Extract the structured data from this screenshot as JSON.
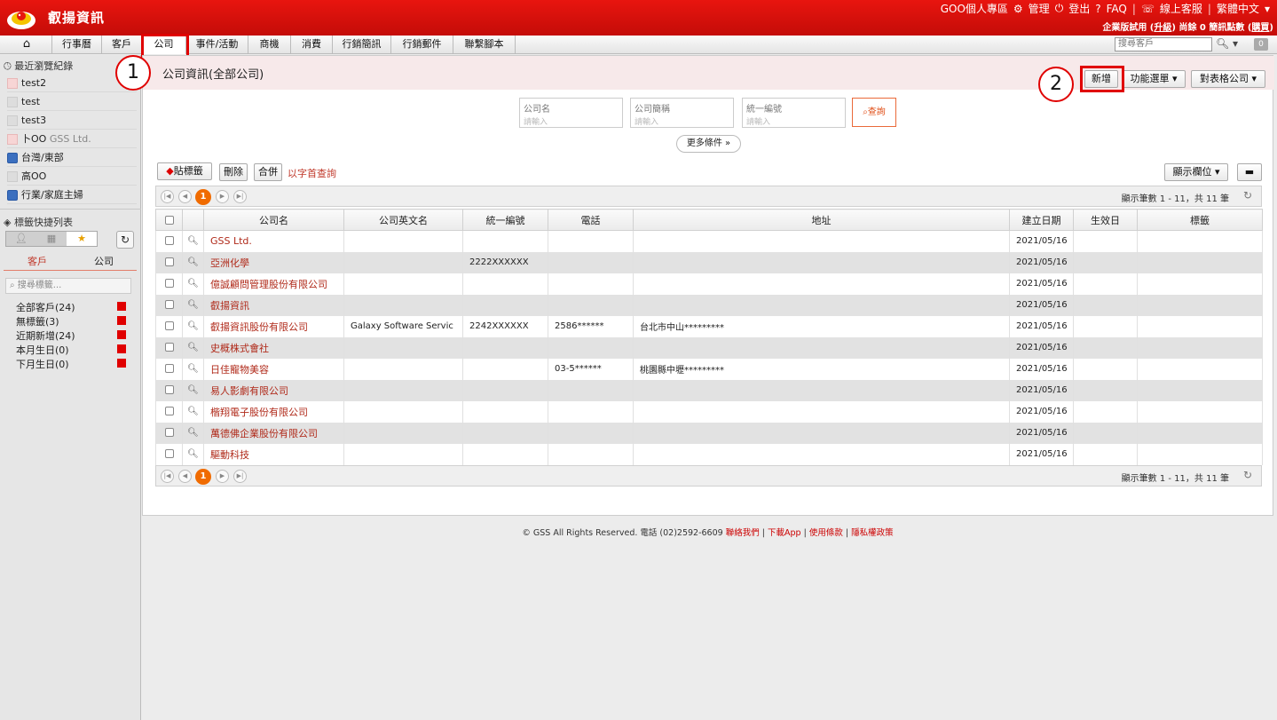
{
  "app": {
    "brand": "叡揚資訊"
  },
  "top_links": {
    "personal": "GOO個人專區",
    "manage": "管理",
    "logout": "登出",
    "faq": "FAQ",
    "support": "線上客服",
    "lang": "繁體中文",
    "plan_prefix": "企業版試用 (",
    "plan_upgrade": "升級",
    "plan_mid": ") 尚餘 0 簡訊點數 (",
    "plan_buy": "購買",
    "plan_suffix": ")"
  },
  "nav": {
    "home_icon": "home-icon",
    "items": [
      "行事曆",
      "客戶",
      "公司",
      "事件/活動",
      "商機",
      "消費",
      "行銷簡訊",
      "行銷郵件",
      "聯繫腳本"
    ],
    "active": "公司",
    "search_placeholder": "搜尋客戶",
    "badge": "0"
  },
  "sidebar": {
    "recent_title": "最近瀏覽紀錄",
    "recent": [
      {
        "label": "test2",
        "icon": "person-icon"
      },
      {
        "label": "test",
        "icon": "person-icon"
      },
      {
        "label": "test3",
        "icon": "person-icon"
      },
      {
        "label": "卜OO",
        "extra": "GSS Ltd.",
        "icon": "person-icon"
      },
      {
        "label": "台灣/東部",
        "icon": "group-icon"
      },
      {
        "label": "高OO",
        "icon": "person-icon"
      },
      {
        "label": "行業/家庭主婦",
        "icon": "group-icon"
      }
    ],
    "tag_title": "標籤快捷列表",
    "tabs": [
      "客戶",
      "公司"
    ],
    "tag_search_placeholder": "搜尋標籤...",
    "tags": [
      "全部客戶(24)",
      "無標籤(3)",
      "近期新增(24)",
      "本月生日(0)",
      "下月生日(0)"
    ],
    "tag_color": "#e00000"
  },
  "main": {
    "title": "公司資訊(全部公司)",
    "add_button": "新增",
    "func_menu": "功能選單",
    "table_company": "對表格公司",
    "search": {
      "company_name": {
        "label": "公司名",
        "placeholder": "請輸入"
      },
      "short_name": {
        "label": "公司簡稱",
        "placeholder": "請輸入"
      },
      "tax_id": {
        "label": "統一編號",
        "placeholder": "請輸入"
      },
      "query": "查詢",
      "more": "更多條件"
    },
    "toolbar": {
      "tag": "貼標籤",
      "delete": "刪除",
      "merge": "合併",
      "initial_query": "以字首查詢",
      "show_columns": "顯示欄位"
    },
    "pager": {
      "current": "1",
      "count_text": "顯示筆數 1 - 11，共 11 筆"
    },
    "columns": [
      "公司名",
      "公司英文名",
      "統一編號",
      "電話",
      "地址",
      "建立日期",
      "生效日",
      "標籤"
    ],
    "rows": [
      {
        "name": "GSS Ltd.",
        "en": "",
        "tax": "",
        "phone": "",
        "addr": "",
        "created": "2021/05/16"
      },
      {
        "name": "亞洲化學",
        "en": "",
        "tax": "2222XXXXXX",
        "phone": "",
        "addr": "",
        "created": "2021/05/16"
      },
      {
        "name": "億誠顧問管理股份有限公司",
        "en": "",
        "tax": "",
        "phone": "",
        "addr": "",
        "created": "2021/05/16"
      },
      {
        "name": "叡揚資訊",
        "en": "",
        "tax": "",
        "phone": "",
        "addr": "",
        "created": "2021/05/16"
      },
      {
        "name": "叡揚資訊股份有限公司",
        "en": "Galaxy Software Servic",
        "tax": "2242XXXXXX",
        "phone": "2586******",
        "addr": "台北市中山*********",
        "created": "2021/05/16"
      },
      {
        "name": "史概株式會社",
        "en": "",
        "tax": "",
        "phone": "",
        "addr": "",
        "created": "2021/05/16"
      },
      {
        "name": "日佳寵物美容",
        "en": "",
        "tax": "",
        "phone": "03-5******",
        "addr": "桃園縣中壢*********",
        "created": "2021/05/16"
      },
      {
        "name": "易人影劇有限公司",
        "en": "",
        "tax": "",
        "phone": "",
        "addr": "",
        "created": "2021/05/16"
      },
      {
        "name": "楷翔電子股份有限公司",
        "en": "",
        "tax": "",
        "phone": "",
        "addr": "",
        "created": "2021/05/16"
      },
      {
        "name": "萬德佛企業股份有限公司",
        "en": "",
        "tax": "",
        "phone": "",
        "addr": "",
        "created": "2021/05/16"
      },
      {
        "name": "驅動科技",
        "en": "",
        "tax": "",
        "phone": "",
        "addr": "",
        "created": "2021/05/16"
      }
    ]
  },
  "footer": {
    "copyright": "© GSS All Rights Reserved. 電話 (02)2592-6609",
    "links": [
      "聯絡我們",
      "下載App",
      "使用條款",
      "隱私權政策"
    ]
  },
  "annotations": {
    "step1": "1",
    "step2": "2",
    "color": "#e00000"
  }
}
